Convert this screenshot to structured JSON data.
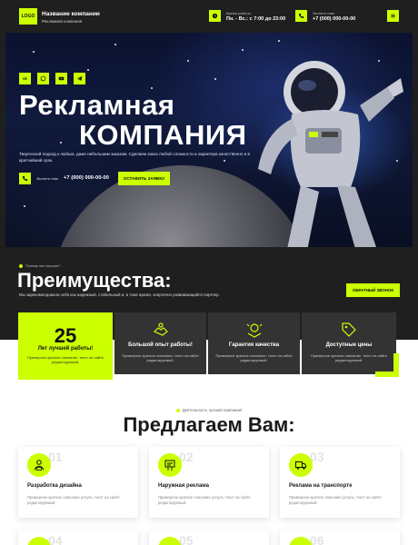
{
  "header": {
    "logo_text": "LOGO",
    "company_name": "Название компании",
    "company_sub": "Рекламная компания",
    "hours_label": "Время работы:",
    "hours_value": "Пн. - Вс.: с 7:00 до 23:00",
    "phone_label": "Звоните нам:",
    "phone_value": "+7 (000) 000-00-00"
  },
  "hero": {
    "title_line1": "Рекламная",
    "title_line2": "КОМПАНИЯ",
    "description": "Творческий подход к любым, даже небольшим заказам. Сделаем заказ любой сложности и характера качественно и в кратчайший срок.",
    "call_label": "Звоните нам:",
    "call_phone": "+7 (000) 000-00-00",
    "order_button": "ОСТАВИТЬ ЗАЯВКУ",
    "social_icons": [
      "vk-icon",
      "whatsapp-icon",
      "youtube-icon",
      "telegram-icon"
    ]
  },
  "advantages": {
    "tag": "Почему мы лучшие?",
    "title": "Преимущества:",
    "description": "Мы зарекомендовали себя как надежный, стабильный и, в тоже время, энергично развивающийся партнер.",
    "callback_button": "ОБРАТНЫЙ ЗВОНОК",
    "cards": [
      {
        "number": "25",
        "title": "Лет лучшей работы!",
        "text": "Примерное краткое описание, текст на сайте редактируемый."
      },
      {
        "title": "Большой опыт работы!",
        "text": "Примерное краткое описание, текст на сайте редактируемый."
      },
      {
        "title": "Гарантия качества",
        "text": "Примерное краткое описание, текст на сайте редактируемый."
      },
      {
        "title": "Доступные цены",
        "text": "Примерное краткое описание, текст на сайте редактируемый."
      }
    ]
  },
  "services": {
    "tag": "Деятельность лучшей компании!",
    "title": "Предлагаем Вам:",
    "items": [
      {
        "num": "01",
        "name": "Разработка дизайна",
        "desc": "Примерное краткое описание услуги, текст на сайте редактируемый."
      },
      {
        "num": "02",
        "name": "Наружная реклама",
        "desc": "Примерное краткое описание услуги, текст на сайте редактируемый."
      },
      {
        "num": "03",
        "name": "Реклама на транспорте",
        "desc": "Примерное краткое описание услуги, текст на сайте редактируемый."
      },
      {
        "num": "04"
      },
      {
        "num": "05"
      },
      {
        "num": "06"
      }
    ]
  },
  "colors": {
    "accent": "#ccff00",
    "dark": "#1f1f1f",
    "card": "#333333"
  }
}
